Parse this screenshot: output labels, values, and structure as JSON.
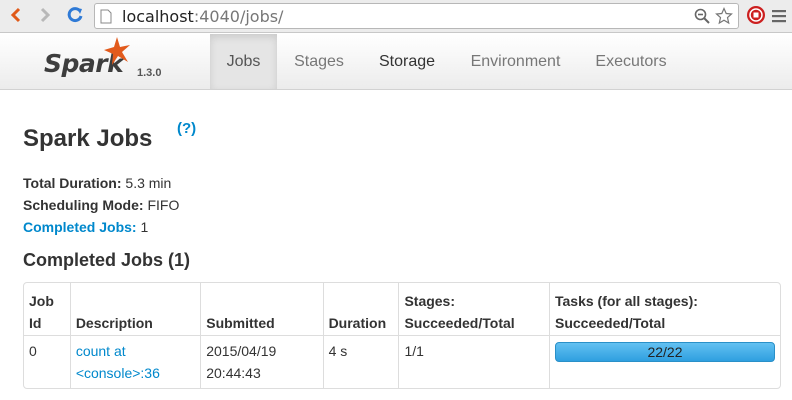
{
  "browser": {
    "url_host": "localhost",
    "url_rest": ":4040/jobs/"
  },
  "spark": {
    "brand": "Spark",
    "version": "1.3.0",
    "tabs": [
      {
        "label": "Jobs",
        "active": true
      },
      {
        "label": "Stages",
        "active": false
      },
      {
        "label": "Storage",
        "active": false
      },
      {
        "label": "Environment",
        "active": false
      },
      {
        "label": "Executors",
        "active": false
      }
    ]
  },
  "page": {
    "title": "Spark Jobs",
    "help": "(?)",
    "total_duration_label": "Total Duration:",
    "total_duration_value": "5.3 min",
    "scheduling_mode_label": "Scheduling Mode:",
    "scheduling_mode_value": "FIFO",
    "completed_jobs_label": "Completed Jobs:",
    "completed_jobs_value": "1",
    "section_title": "Completed Jobs (1)"
  },
  "table": {
    "headers": {
      "job_id_1": "Job",
      "job_id_2": "Id",
      "description": "Description",
      "submitted": "Submitted",
      "duration": "Duration",
      "stages_1": "Stages:",
      "stages_2": "Succeeded/Total",
      "tasks_1": "Tasks (for all stages):",
      "tasks_2": "Succeeded/Total"
    },
    "rows": [
      {
        "job_id": "0",
        "description_1": "count at",
        "description_2": "<console>:36",
        "submitted_1": "2015/04/19",
        "submitted_2": "20:44:43",
        "duration": "4 s",
        "stages": "1/1",
        "tasks": "22/22",
        "tasks_fraction": 1.0
      }
    ]
  },
  "colors": {
    "link": "#0088cc",
    "progress": "#3ba8e6",
    "spark_orange": "#e25a1c"
  }
}
